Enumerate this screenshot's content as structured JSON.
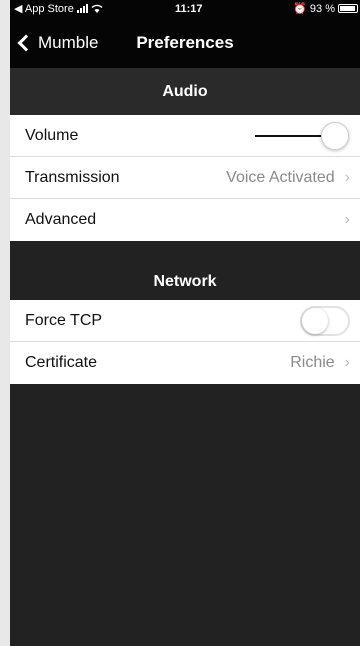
{
  "status_bar": {
    "back_app": "◀ App Store",
    "time": "11:17",
    "alarm_icon": "alarm-icon",
    "battery_percent": "93 %"
  },
  "nav": {
    "back_label": "Mumble",
    "title": "Preferences"
  },
  "sections": {
    "audio": {
      "header": "Audio",
      "volume_label": "Volume",
      "volume_level": 1.0,
      "transmission_label": "Transmission",
      "transmission_value": "Voice Activated",
      "advanced_label": "Advanced"
    },
    "network": {
      "header": "Network",
      "force_tcp_label": "Force TCP",
      "force_tcp_on": false,
      "certificate_label": "Certificate",
      "certificate_value": "Richie"
    }
  },
  "colors": {
    "nav_bg": "#050505",
    "page_bg": "#222222",
    "row_text": "#111111",
    "detail_text": "#8a8a8a"
  }
}
